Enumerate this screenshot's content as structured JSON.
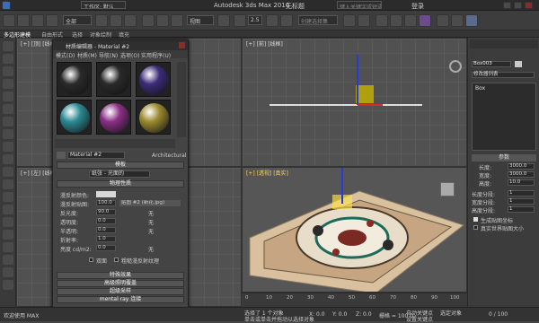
{
  "app": {
    "title": "Autodesk 3ds Max 2016",
    "file": "无标题",
    "workspace": "工作区: 默认",
    "search_placeholder": "键入关键字或短语",
    "login": "登录"
  },
  "toolbar": {
    "view_dropdown": "视图",
    "selection_dropdown": "全部",
    "snap_label": "2.5",
    "create_set_placeholder": "创建选择集"
  },
  "ribbon": {
    "tabs": [
      "多边形建模",
      "自由形式",
      "选择",
      "对象绘制",
      "填充"
    ],
    "active": "多边形建模"
  },
  "viewports": {
    "top_left": "[+] [顶] [线框]",
    "top_right": "[+] [前] [线框]",
    "bottom_left": "[+] [左] [线框]",
    "bottom_right": "[+] [透视] [真实]"
  },
  "material_editor": {
    "title": "材质编辑器 - Material #2",
    "menu": [
      "模式(D)",
      "材质(M)",
      "导航(N)",
      "选项(O)",
      "实用程序(U)"
    ],
    "slot_colors": [
      "#2a2a2a",
      "#2a2a2a",
      "#3c2c7a",
      "#2b8a94",
      "#8a2f86",
      "#9a8a2e"
    ],
    "material_name": "Material #2",
    "material_type": "Architectural",
    "rollouts": {
      "templates": "模板",
      "template_value": "纸张 - 光面的",
      "physical": "物理性质",
      "special": "特殊效果",
      "advanced": "高级照明覆盖",
      "supersampling": "超级采样",
      "mentalray": "mental ray 连接"
    },
    "params": [
      {
        "label": "漫反射颜色:",
        "value": ""
      },
      {
        "label": "漫反射贴图:",
        "value": "100.0"
      },
      {
        "label": "反光度:",
        "value": "90.0"
      },
      {
        "label": "透明度:",
        "value": "0.0"
      },
      {
        "label": "半透明:",
        "value": "0.0"
      },
      {
        "label": "折射率:",
        "value": "1.0"
      },
      {
        "label": "亮度 cd/m2:",
        "value": "0.0"
      }
    ],
    "map_name": "贴图 #2 (新花.jpg)",
    "none_label": "无",
    "checkbox_two_sided": "双面",
    "checkbox_raw_diffuse": "粗糙漫反射纹理"
  },
  "right_panel": {
    "object_name": "Box003",
    "modifier_list": "修改器列表",
    "stack_item": "Box",
    "params_title": "参数",
    "params": [
      {
        "label": "长度:",
        "value": "3000.0"
      },
      {
        "label": "宽度:",
        "value": "3000.0"
      },
      {
        "label": "高度:",
        "value": "10.0"
      },
      {
        "label": "长度分段:",
        "value": "1"
      },
      {
        "label": "宽度分段:",
        "value": "1"
      },
      {
        "label": "高度分段:",
        "value": "1"
      }
    ],
    "gen_uv": "生成贴图坐标",
    "real_world": "真实世界贴图大小"
  },
  "status": {
    "selected": "选择了 1 个对象",
    "hint": "单击或单击并拖动以选择对象",
    "x": "X: 0.0",
    "y": "Y: 0.0",
    "z": "Z: 0.0",
    "grid": "栅格 = 100.0",
    "autokey": "自动关键点",
    "setkey": "设置关键点",
    "selected_label": "选定对象",
    "welcome": "欢迎使用 MAX",
    "frame": "0 / 100"
  },
  "timeline": {
    "ticks": [
      "0",
      "10",
      "20",
      "30",
      "40",
      "50",
      "60",
      "70",
      "80",
      "90",
      "100"
    ]
  }
}
